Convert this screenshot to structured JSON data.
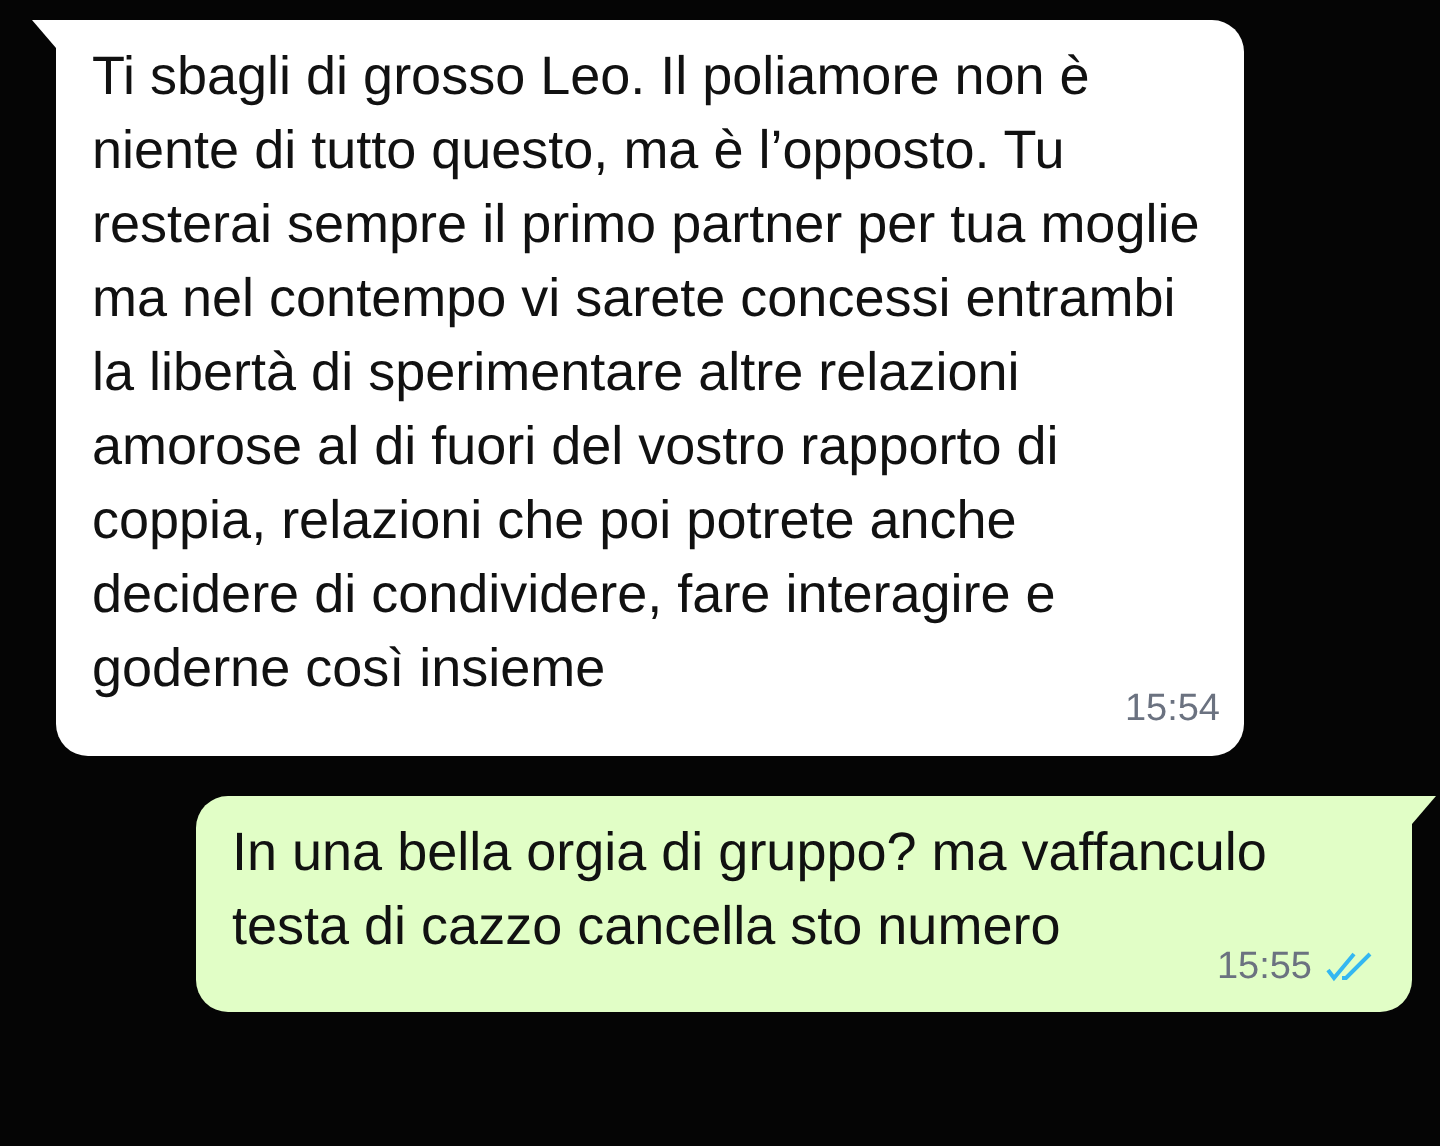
{
  "messages": [
    {
      "kind": "incoming",
      "text": "Ti sbagli di grosso Leo. Il poliamore non è niente di tutto questo, ma è l’opposto. Tu resterai sempre il primo partner per tua moglie ma nel contempo vi sarete concessi entrambi la libertà di sperimentare altre relazioni amorose al di fuori del vostro rapporto di coppia, relazioni che poi potrete anche decidere di condividere, fare interagire e goderne così insieme",
      "time": "15:54"
    },
    {
      "kind": "outgoing",
      "text": "In una bella orgia di gruppo? ma vaffanculo testa di cazzo cancella sto numero",
      "time": "15:55",
      "read": true
    }
  ]
}
